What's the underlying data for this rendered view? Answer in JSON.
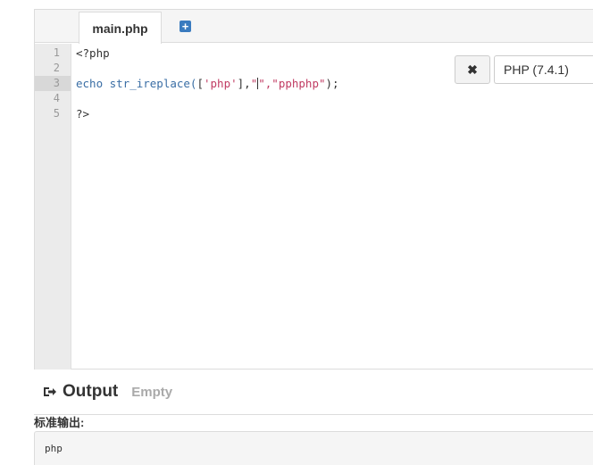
{
  "editor": {
    "tab_label": "main.php",
    "add_tab_symbol": "+",
    "line_numbers": [
      "1",
      "2",
      "3",
      "4",
      "5"
    ],
    "active_line": "3",
    "code": {
      "line1": "<?php",
      "line3_keyword": "echo str_ireplace(",
      "line3_bracket_open": "[",
      "line3_arg1": "'php'",
      "line3_bracket_close": "],",
      "line3_arg2_open": "\"",
      "line3_arg2_close": "\",",
      "line3_arg3": "\"pphphp\"",
      "line3_end": ");",
      "line5": "?>"
    }
  },
  "toolbar": {
    "clear_button": "✖",
    "language": "PHP (7.4.1)"
  },
  "output": {
    "title": "Output",
    "status": "Empty",
    "stdout_label": "标准输出:",
    "stdout_value": "php"
  }
}
